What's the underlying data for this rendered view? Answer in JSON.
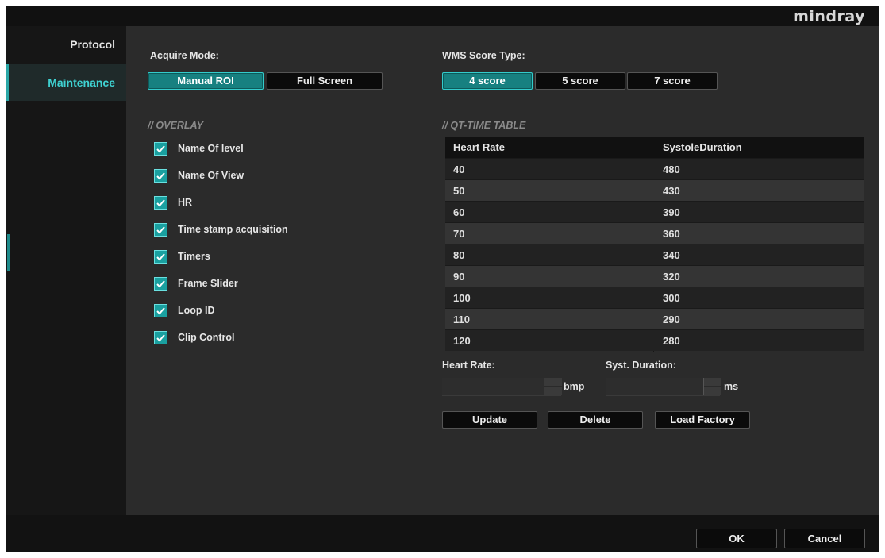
{
  "header": {
    "brand": "mindray"
  },
  "sidebar": {
    "items": [
      {
        "label": "Protocol"
      },
      {
        "label": "Maintenance"
      }
    ]
  },
  "acquire_mode": {
    "label": "Acquire Mode:",
    "options": [
      "Manual ROI",
      "Full Screen"
    ],
    "selected": "Manual ROI"
  },
  "wms_score": {
    "label": "WMS Score Type:",
    "options": [
      "4 score",
      "5 score",
      "7 score"
    ],
    "selected": "4 score"
  },
  "overlay": {
    "title": "OVERLAY",
    "items": [
      {
        "label": "Name Of level",
        "checked": true
      },
      {
        "label": "Name Of View",
        "checked": true
      },
      {
        "label": "HR",
        "checked": true
      },
      {
        "label": "Time stamp acquisition",
        "checked": true
      },
      {
        "label": "Timers",
        "checked": true
      },
      {
        "label": "Frame Slider",
        "checked": true
      },
      {
        "label": "Loop ID",
        "checked": true
      },
      {
        "label": "Clip Control",
        "checked": true
      }
    ]
  },
  "qt_table": {
    "title": "QT-TIME TABLE",
    "headers": [
      "Heart Rate",
      "SystoleDuration"
    ],
    "rows": [
      [
        "40",
        "480"
      ],
      [
        "50",
        "430"
      ],
      [
        "60",
        "390"
      ],
      [
        "70",
        "360"
      ],
      [
        "80",
        "340"
      ],
      [
        "90",
        "320"
      ],
      [
        "100",
        "300"
      ],
      [
        "110",
        "290"
      ],
      [
        "120",
        "280"
      ]
    ]
  },
  "inputs": {
    "heart_rate_label": "Heart Rate:",
    "heart_rate_unit": "bmp",
    "heart_rate_value": "",
    "syst_duration_label": "Syst. Duration:",
    "syst_duration_unit": "ms",
    "syst_duration_value": ""
  },
  "table_buttons": {
    "update": "Update",
    "delete": "Delete",
    "load_factory": "Load Factory"
  },
  "footer": {
    "ok": "OK",
    "cancel": "Cancel"
  },
  "colors": {
    "accent": "#178080",
    "accent_text": "#3fd3d3",
    "panel": "#2b2b2b",
    "sidebar": "#161616"
  }
}
